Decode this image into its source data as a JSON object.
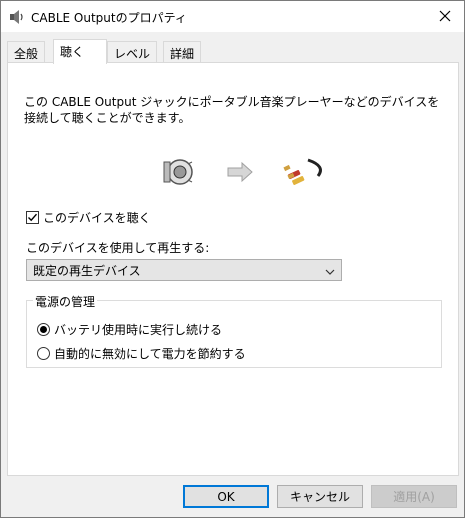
{
  "window": {
    "title": "CABLE Outputのプロパティ",
    "icon": "speaker-icon"
  },
  "tabs": [
    {
      "label": "全般",
      "active": false
    },
    {
      "label": "聴く",
      "active": true
    },
    {
      "label": "レベル",
      "active": false
    },
    {
      "label": "詳細",
      "active": false
    }
  ],
  "listen": {
    "description": "この CABLE Output ジャックにポータブル音楽プレーヤーなどのデバイスを接続して聴くことができます。",
    "listen_checkbox_label": "このデバイスを聴く",
    "listen_checked": true,
    "playback_label": "このデバイスを使用して再生する:",
    "playback_value": "既定の再生デバイス"
  },
  "power": {
    "group_title": "電源の管理",
    "options": [
      {
        "label": "バッテリ使用時に実行し続ける",
        "selected": true
      },
      {
        "label": "自動的に無効にして電力を節約する",
        "selected": false
      }
    ]
  },
  "buttons": {
    "ok": "OK",
    "cancel": "キャンセル",
    "apply": "適用(A)"
  },
  "colors": {
    "default_button_border": "#0078d7",
    "disabled_text": "#a0a0a0"
  }
}
